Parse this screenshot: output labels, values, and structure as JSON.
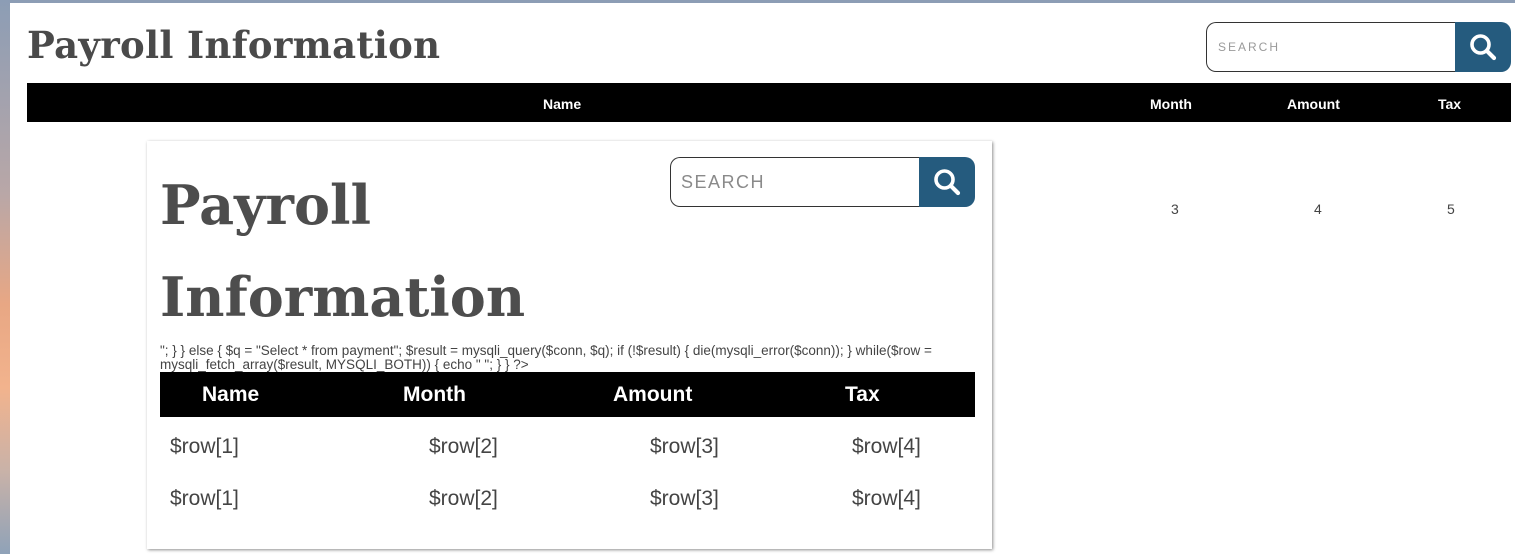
{
  "page": {
    "title": "Payroll Information"
  },
  "search": {
    "placeholder": "SEARCH",
    "button_icon": "search-icon"
  },
  "outer_table": {
    "columns": [
      "Name",
      "Month",
      "Amount",
      "Tax"
    ],
    "row": [
      "3",
      "4",
      "5"
    ]
  },
  "embedded": {
    "title_line1": "Payroll",
    "title_line2": "Information",
    "search_placeholder": "SEARCH",
    "code_text": "\"; } } else { $q = \"Select * from payment\"; $result = mysqli_query($conn, $q); if (!$result) { die(mysqli_error($conn)); } while($row = mysqli_fetch_array($result, MYSQLI_BOTH)) { echo \" \"; } } ?>",
    "columns": [
      "Name",
      "Month",
      "Amount",
      "Tax"
    ],
    "rows": [
      [
        "$row[1]",
        "$row[2]",
        "$row[3]",
        "$row[4]"
      ],
      [
        "$row[1]",
        "$row[2]",
        "$row[3]",
        "$row[4]"
      ]
    ]
  },
  "colors": {
    "accent": "#255b7e",
    "header_bg": "#000000",
    "text": "#4a4a4a"
  }
}
